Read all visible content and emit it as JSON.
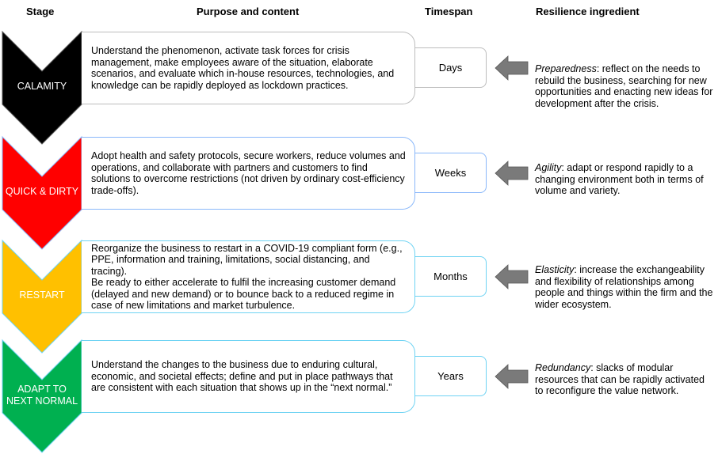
{
  "headers": {
    "stage": "Stage",
    "purpose": "Purpose and content",
    "timespan": "Timespan",
    "resilience": "Resilience ingredient"
  },
  "rows": [
    {
      "stage": "CALAMITY",
      "color": "#000000",
      "border": "#bdbdbd",
      "purpose": "Understand the phenomenon, activate task forces for crisis management, make employees aware of the situation, elaborate scenarios, and evaluate which in-house resources, technologies, and knowledge can be rapidly deployed as lockdown practices.",
      "timespan": "Days",
      "ingredient": "Preparedness",
      "ingredient_text": ": reflect on the needs to rebuild the business, searching for new opportunities and enacting new ideas for development after the crisis."
    },
    {
      "stage": "QUICK & DIRTY",
      "color": "#ff0000",
      "border": "#8ab8fa",
      "purpose": "Adopt health and safety protocols, secure workers, reduce volumes and operations, and collaborate with partners and customers to find solutions to overcome restrictions (not driven by ordinary cost-efficiency trade-offs).",
      "timespan": "Weeks",
      "ingredient": "Agility",
      "ingredient_text": ": adapt or respond rapidly to a changing environment both in terms of volume and variety."
    },
    {
      "stage": "RESTART",
      "color": "#ffc000",
      "border": "#6fd3f3",
      "purpose": "Reorganize the business to restart in a COVID-19 compliant form (e.g., PPE, information and training, limitations, social distancing, and tracing).\nBe ready to either accelerate to fulfil the increasing customer demand (delayed and new demand) or to bounce back to a reduced regime in case of new limitations and market turbulence.",
      "timespan": "Months",
      "ingredient": "Elasticity",
      "ingredient_text": ": increase the exchangeability and flexibility of relationships among people and things within the firm and the wider ecosystem."
    },
    {
      "stage": "ADAPT TO NEXT NORMAL",
      "color": "#00b050",
      "border": "#6fd3f3",
      "purpose": "Understand the changes to the business due to enduring cultural, economic, and societal effects; define and put in place pathways that are consistent with each situation that shows up in the “next normal.”",
      "timespan": "Years",
      "ingredient": "Redundancy",
      "ingredient_text": ": slacks of modular resources that can be rapidly activated to reconfigure the value network."
    }
  ],
  "arrow_color": "#7a7a7a"
}
